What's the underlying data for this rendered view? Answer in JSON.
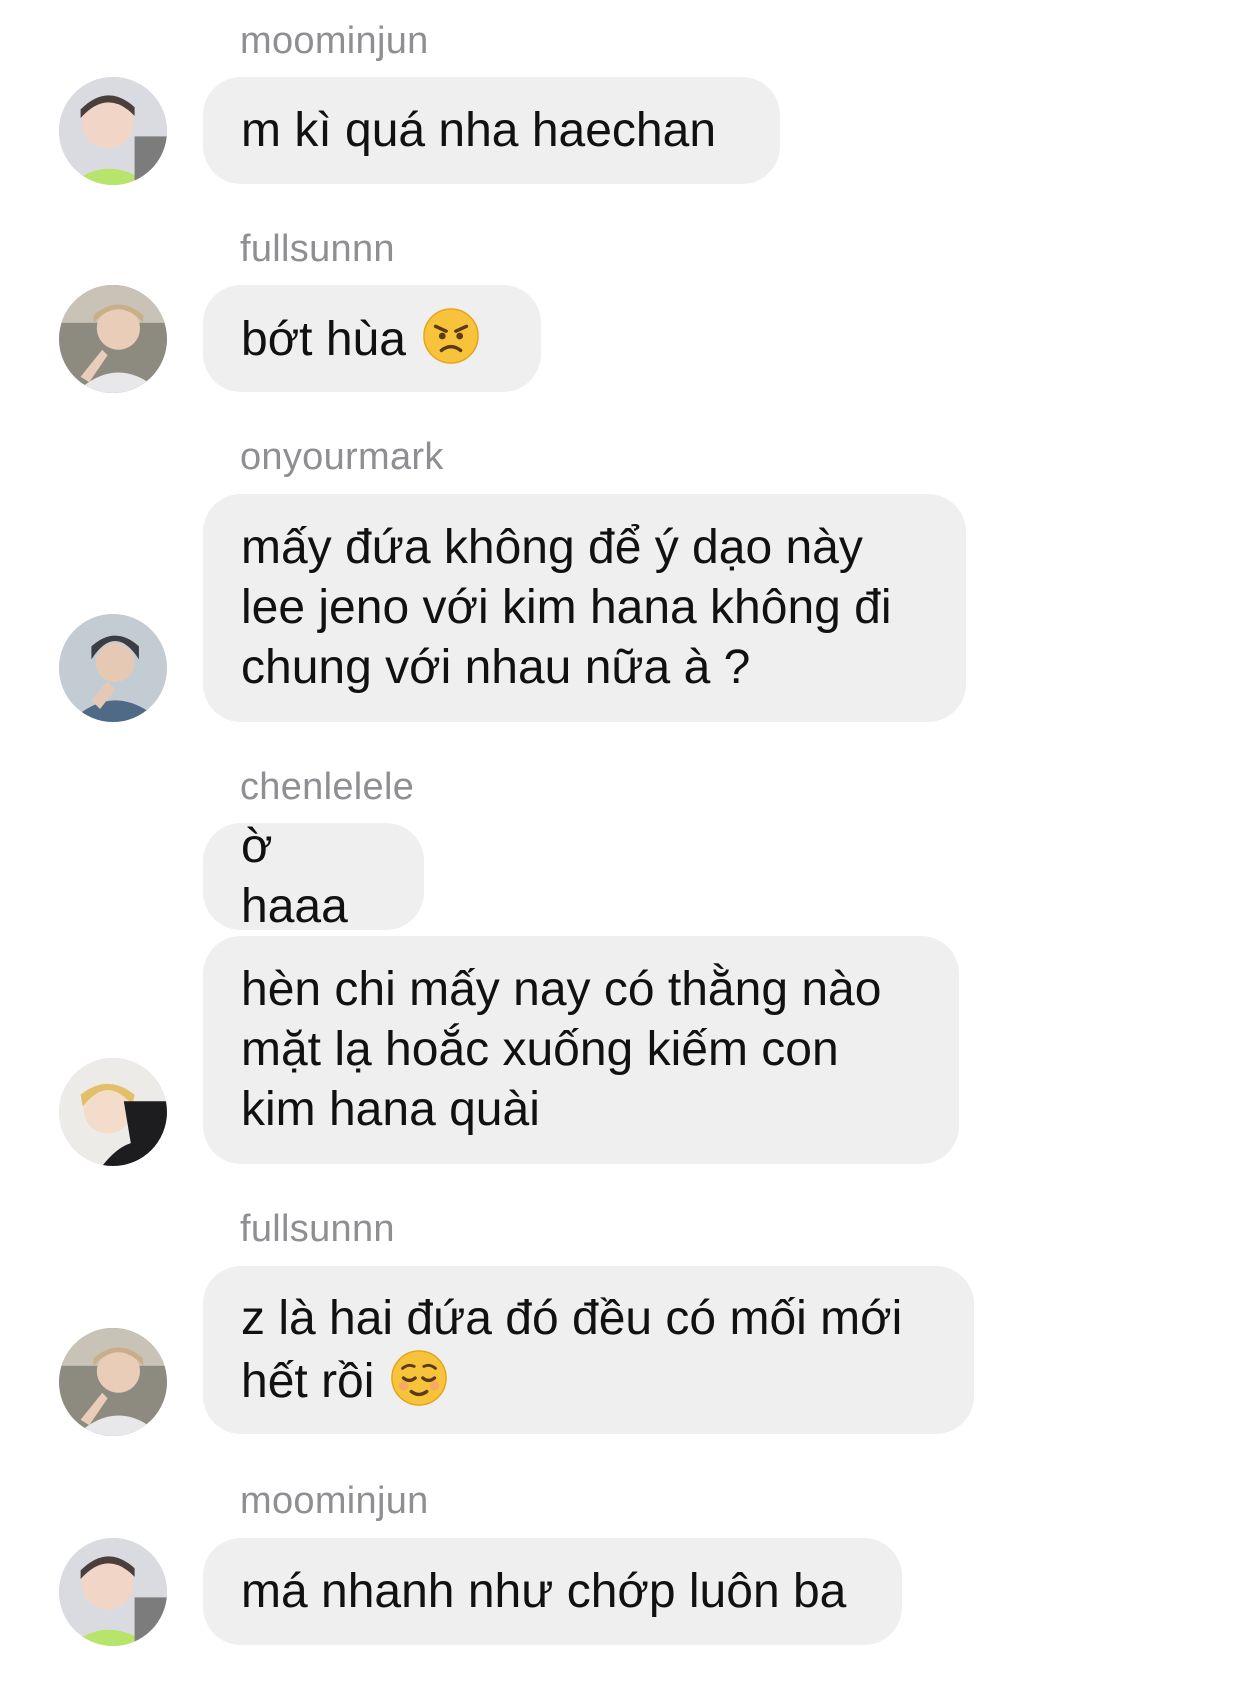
{
  "messages": [
    {
      "username": "moominjun",
      "text": "m kì quá nha haechan",
      "avatar": "avatar-moominjun"
    },
    {
      "username": "fullsunnn",
      "text": "bớt hùa",
      "emoji": "angry-face-emoji",
      "avatar": "avatar-fullsunnn"
    },
    {
      "username": "onyourmark",
      "text": "mấy đứa không để ý dạo này\nlee jeno với kim hana không đi\nchung với nhau nữa à ?",
      "avatar": "avatar-onyourmark"
    },
    {
      "username": "chenlelele",
      "text": "ờ haaa"
    },
    {
      "text": "hèn chi mấy nay có thằng nào\nmặt lạ hoắc xuống kiếm con\nkim hana quài",
      "avatar": "avatar-chenlelele"
    },
    {
      "username": "fullsunnn",
      "text": "z là hai đứa đó đều có mối mới\nhết rồi",
      "emoji": "relieved-face-emoji",
      "avatar": "avatar-fullsunnn"
    },
    {
      "username": "moominjun",
      "text": "má nhanh như chớp luôn ba",
      "avatar": "avatar-moominjun"
    }
  ],
  "colors": {
    "bubble": "#efefef",
    "username": "#8e8e93",
    "text": "#111111",
    "emoji_yellow": "#f7c33a"
  }
}
